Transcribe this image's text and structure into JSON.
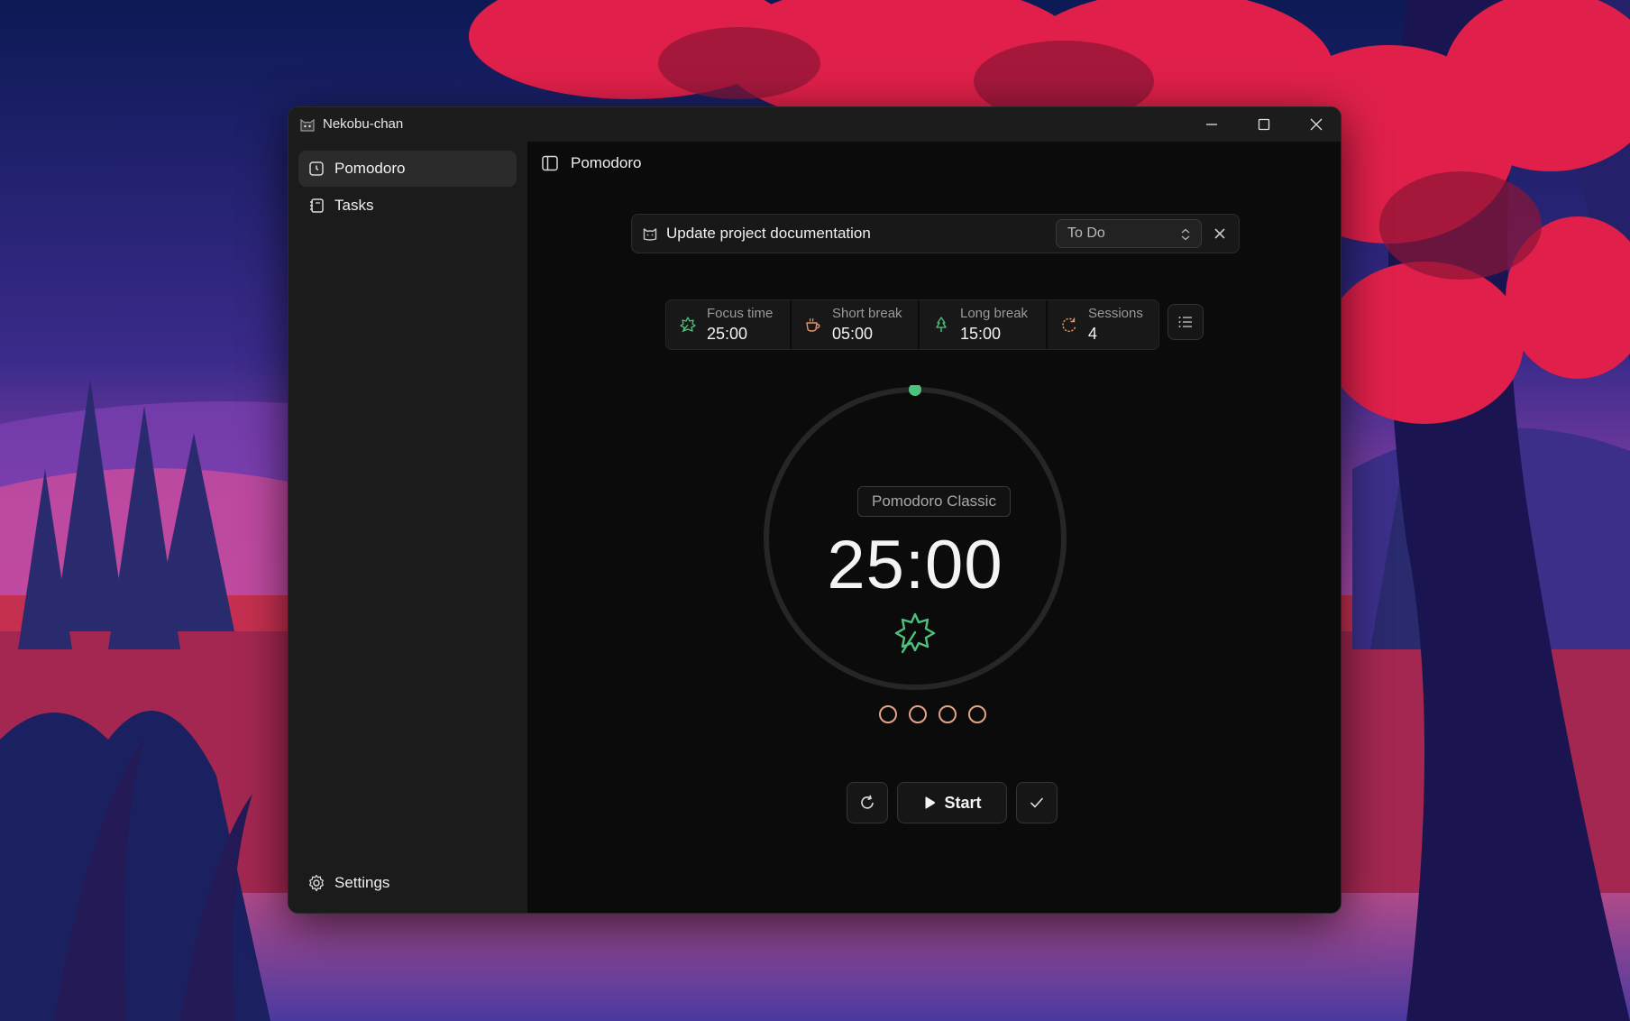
{
  "window": {
    "title": "Nekobu-chan"
  },
  "sidebar": {
    "items": [
      {
        "label": "Pomodoro",
        "icon": "clock-note-icon",
        "active": true
      },
      {
        "label": "Tasks",
        "icon": "notebook-icon",
        "active": false
      }
    ],
    "settings_label": "Settings"
  },
  "header": {
    "title": "Pomodoro"
  },
  "task": {
    "text": "Update project documentation",
    "status": "To Do"
  },
  "stats": [
    {
      "label": "Focus time",
      "value": "25:00",
      "icon": "leaf-icon"
    },
    {
      "label": "Short break",
      "value": "05:00",
      "icon": "coffee-cup-icon"
    },
    {
      "label": "Long break",
      "value": "15:00",
      "icon": "tree-icon"
    },
    {
      "label": "Sessions",
      "value": "4",
      "icon": "loop-icon"
    }
  ],
  "timer": {
    "preset": "Pomodoro Classic",
    "time": "25:00",
    "progress": 0,
    "sessions_completed": 0,
    "sessions_total": 4
  },
  "controls": {
    "start_label": "Start"
  },
  "colors": {
    "accent_green": "#4ec27c",
    "session_dot": "#e3a487",
    "stat_icon_orange": "#e39466"
  }
}
